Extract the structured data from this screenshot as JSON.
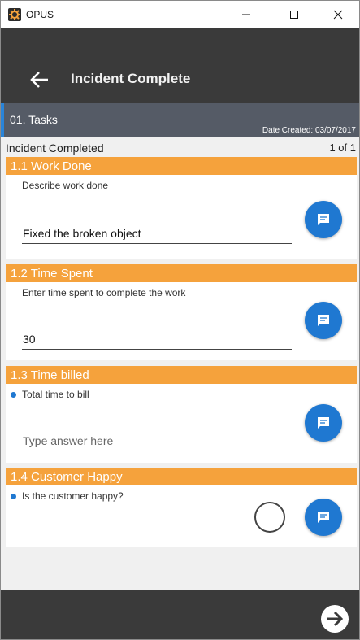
{
  "window": {
    "title": "OPUS",
    "controls": {
      "minimize": "minimize",
      "maximize": "maximize",
      "close": "close"
    }
  },
  "appbar": {
    "title": "Incident Complete",
    "back_icon": "arrow-left-icon"
  },
  "section": {
    "title": "01. Tasks",
    "date_created": "Date Created: 03/07/2017",
    "accent_color": "#2a84d8"
  },
  "status": {
    "label": "Incident Completed",
    "page_indicator": "1 of 1"
  },
  "questions": [
    {
      "title": "1.1 Work Done",
      "description": "Describe work done",
      "required": false,
      "answer": "Fixed the broken object",
      "placeholder": ""
    },
    {
      "title": "1.2 Time Spent",
      "description": "Enter time spent to complete the work",
      "required": false,
      "answer": "30",
      "placeholder": ""
    },
    {
      "title": "1.3 Time billed",
      "description": "Total time to bill",
      "required": true,
      "answer": "",
      "placeholder": "Type answer here"
    },
    {
      "title": "1.4 Customer Happy",
      "description": "Is the customer happy?",
      "required": true,
      "type": "checkbox",
      "checked": false
    }
  ],
  "icons": {
    "comment": "comment-icon",
    "next": "arrow-right-circle-icon"
  },
  "colors": {
    "header_orange": "#f5a23c",
    "action_blue": "#1f78d1",
    "bar_dark": "#3a3a3a",
    "section_gray": "#555b66"
  }
}
